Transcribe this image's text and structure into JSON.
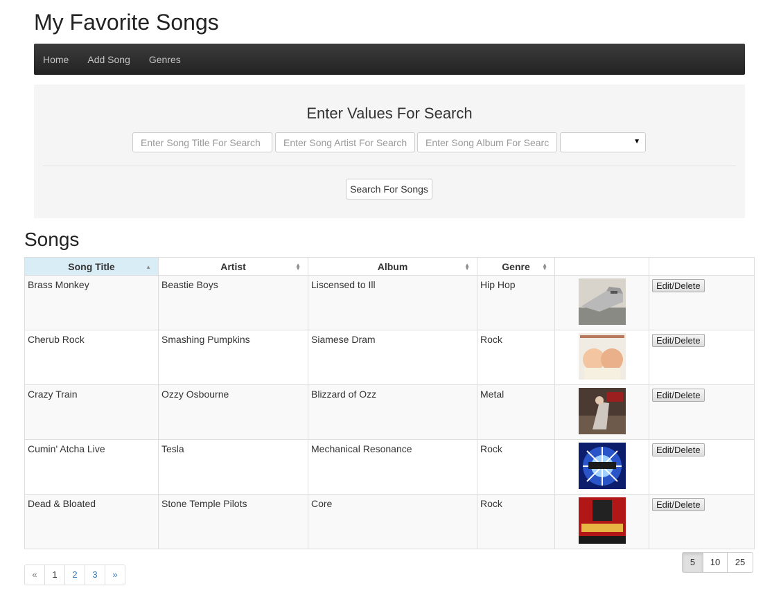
{
  "app": {
    "title": "My Favorite Songs"
  },
  "nav": {
    "items": [
      {
        "label": "Home"
      },
      {
        "label": "Add Song"
      },
      {
        "label": "Genres"
      }
    ]
  },
  "search": {
    "heading": "Enter Values For Search",
    "title_placeholder": "Enter Song Title For Search",
    "artist_placeholder": "Enter Song Artist For Search",
    "album_placeholder": "Enter Song Album For Search",
    "genre_value": "",
    "button_label": "Search For Songs"
  },
  "songs_section": {
    "title": "Songs",
    "columns": [
      "Song Title",
      "Artist",
      "Album",
      "Genre",
      "",
      ""
    ],
    "sorted_column": "Song Title",
    "rows": [
      {
        "title": "Brass Monkey",
        "artist": "Beastie Boys",
        "album": "Liscensed to Ill",
        "genre": "Hip Hop",
        "cover_icon": "album-cover-licensed-to-ill",
        "action": "Edit/Delete"
      },
      {
        "title": "Cherub Rock",
        "artist": "Smashing Pumpkins",
        "album": "Siamese Dram",
        "genre": "Rock",
        "cover_icon": "album-cover-siamese-dream",
        "action": "Edit/Delete"
      },
      {
        "title": "Crazy Train",
        "artist": "Ozzy Osbourne",
        "album": "Blizzard of Ozz",
        "genre": "Metal",
        "cover_icon": "album-cover-blizzard-of-ozz",
        "action": "Edit/Delete"
      },
      {
        "title": "Cumin' Atcha Live",
        "artist": "Tesla",
        "album": "Mechanical Resonance",
        "genre": "Rock",
        "cover_icon": "album-cover-mechanical-resonance",
        "action": "Edit/Delete"
      },
      {
        "title": "Dead & Bloated",
        "artist": "Stone Temple Pilots",
        "album": "Core",
        "genre": "Rock",
        "cover_icon": "album-cover-core",
        "action": "Edit/Delete"
      }
    ]
  },
  "pagination": {
    "prev": "«",
    "pages": [
      "1",
      "2",
      "3"
    ],
    "next": "»"
  },
  "page_size": {
    "options": [
      "5",
      "10",
      "25"
    ],
    "selected": "5"
  },
  "colors": {
    "navbar": "#222222",
    "sorted_header": "#d9edf7",
    "link": "#337ab7"
  }
}
